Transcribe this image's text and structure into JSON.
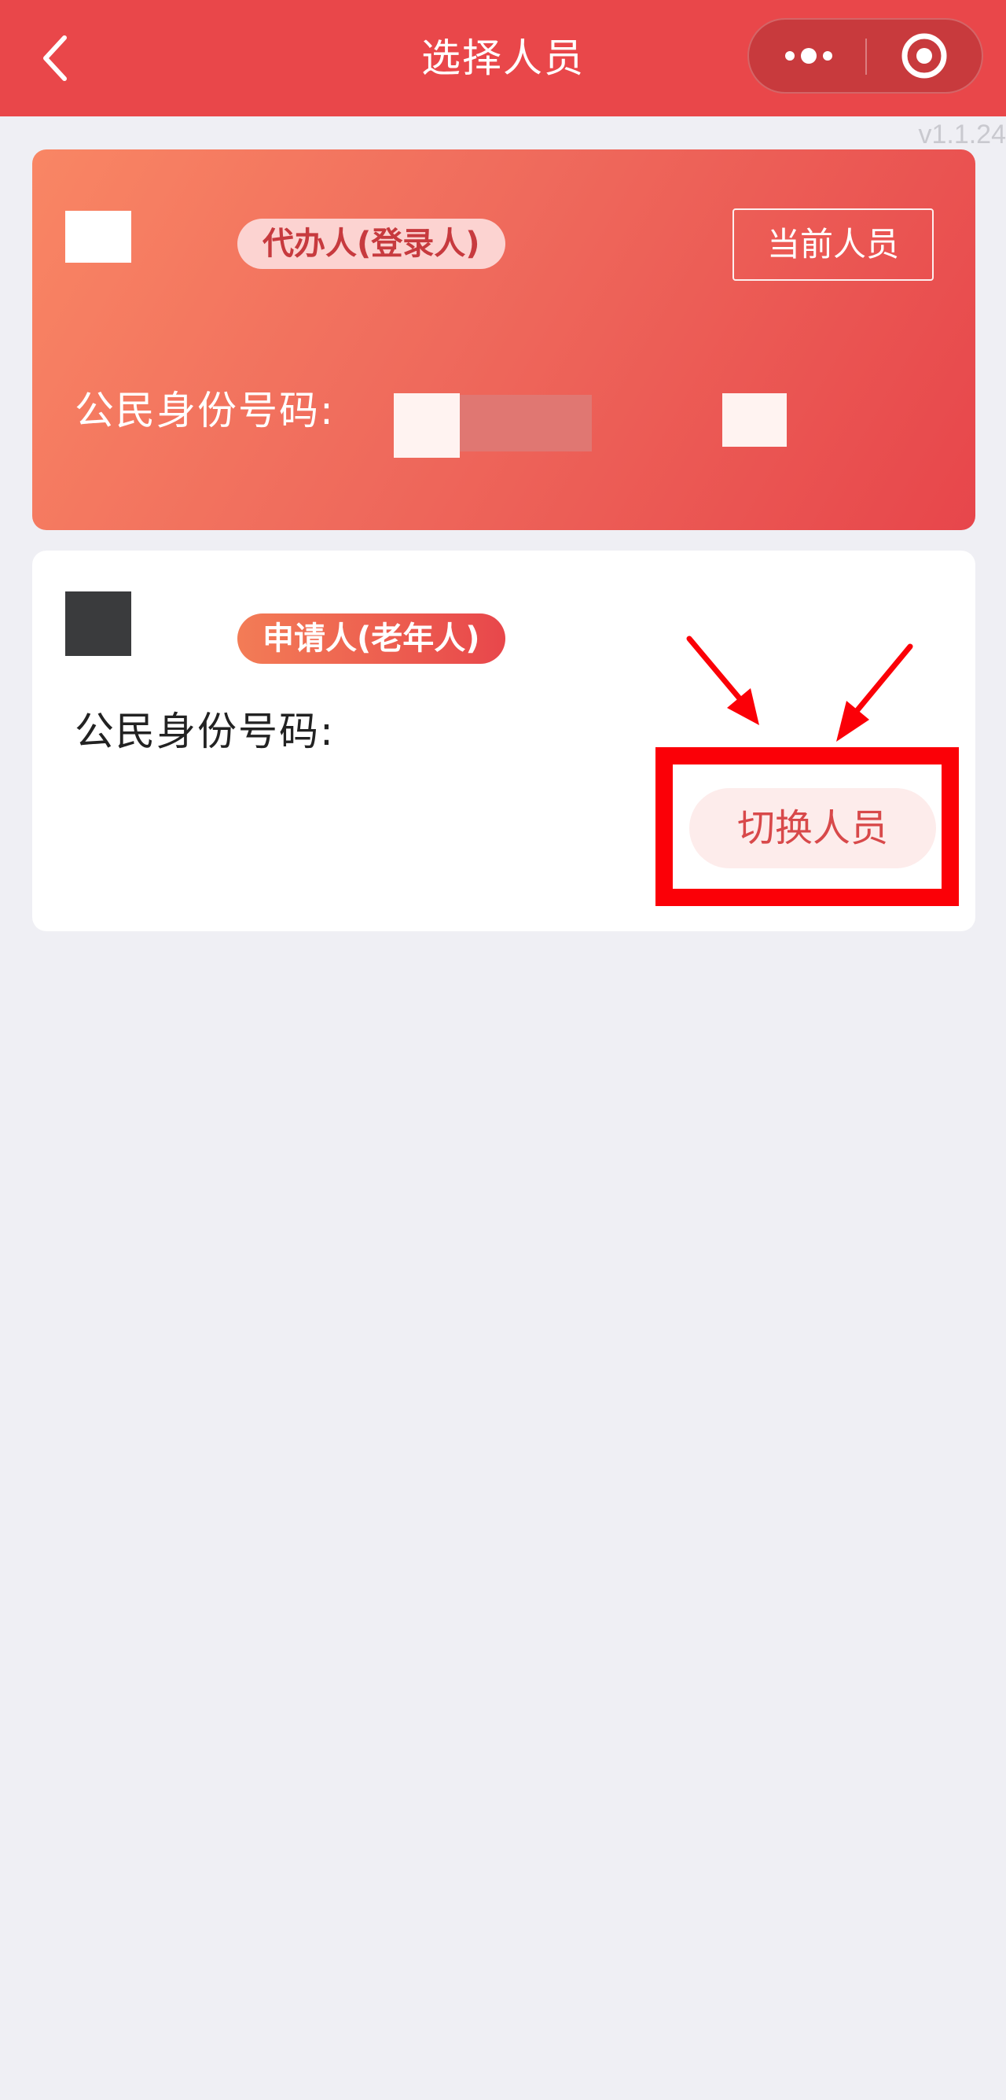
{
  "nav": {
    "title": "选择人员",
    "back_icon": "chevron-left-icon",
    "more_icon": "more-dots-icon",
    "close_icon": "target-circle-icon"
  },
  "version": "v1.1.24",
  "agent_card": {
    "role_tag": "代办人(登录人)",
    "current_label": "当前人员",
    "id_label": "公民身份号码:"
  },
  "applicant_card": {
    "role_tag": "申请人(老年人)",
    "id_label": "公民身份号码:",
    "switch_label": "切换人员"
  },
  "colors": {
    "nav_bg": "#e9474a",
    "page_bg": "#efeff4",
    "card_gradient_start": "#f98664",
    "card_gradient_end": "#e7464b",
    "accent_text": "#d8494a",
    "annotation_red": "#fb0007"
  }
}
